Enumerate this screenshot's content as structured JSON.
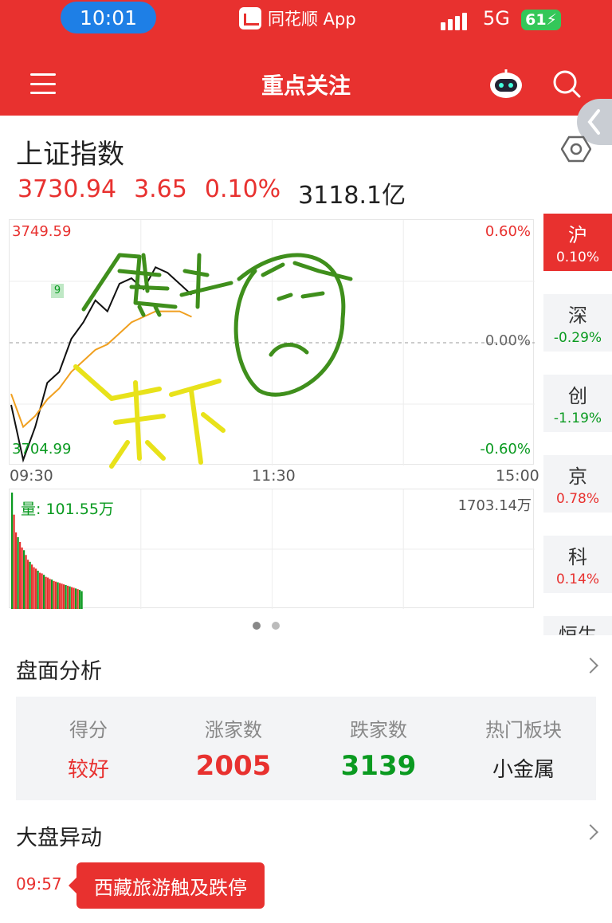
{
  "status_bar": {
    "time": "10:01",
    "app_name": "同花顺 App",
    "network": "5G",
    "battery": "61"
  },
  "header": {
    "title": "重点关注",
    "icons": [
      "menu-icon",
      "robot-assistant-icon",
      "search-icon"
    ]
  },
  "index": {
    "name": "上证指数",
    "price": "3730.94",
    "change": "3.65",
    "change_pct": "0.10%",
    "turnover": "3118.1亿"
  },
  "chart": {
    "high_label": "3749.59",
    "low_label": "3704.99",
    "pct_top": "0.60%",
    "pct_mid": "0.00%",
    "pct_bottom": "-0.60%",
    "marker": "9",
    "times": [
      "09:30",
      "11:30",
      "15:00"
    ],
    "volume_label": "量: 101.55万",
    "volume_max": "1703.14万",
    "colors": {
      "up": "#e8312f",
      "down": "#0a9a20",
      "price_line": "#111111",
      "avg_line": "#f0a020"
    }
  },
  "chart_data": {
    "type": "line",
    "title": "上证指数",
    "xlabel": "",
    "ylabel": "",
    "x_ticks": [
      "09:30",
      "11:30",
      "15:00"
    ],
    "ylim": [
      3704.99,
      3749.59
    ],
    "prev_close": 3727.29,
    "series": [
      {
        "name": "",
        "values": [
          3716,
          3706,
          3712,
          3720,
          3722,
          3728,
          3731,
          3735,
          3733,
          3738,
          3739,
          3737,
          3741,
          3740,
          3738,
          3736
        ]
      },
      {
        "name": "",
        "values": [
          3718,
          3712,
          3714,
          3717,
          3719,
          3722,
          3724,
          3726,
          3727,
          3729,
          3731,
          3732,
          3733,
          3733,
          3733,
          3732
        ]
      }
    ],
    "volume": {
      "values": [
        1703,
        1380,
        1120,
        1050,
        980,
        900,
        860,
        790,
        720,
        690,
        650,
        610,
        590,
        560,
        530,
        520,
        500,
        470,
        460,
        440,
        430,
        410,
        400,
        390,
        380,
        370,
        360,
        350,
        340,
        330,
        320,
        310,
        300,
        290,
        280,
        260
      ],
      "up": [
        false,
        true,
        true,
        false,
        true,
        true,
        false,
        true,
        true,
        false,
        true,
        true,
        true,
        false,
        true,
        true,
        false,
        true,
        true,
        true,
        false,
        true,
        true,
        false,
        true,
        true,
        true,
        false,
        true,
        false,
        true,
        true,
        false,
        true,
        false,
        false
      ]
    }
  },
  "side_tabs": [
    {
      "label": "沪",
      "value": "0.10%",
      "direction": "up",
      "active": true
    },
    {
      "label": "深",
      "value": "-0.29%",
      "direction": "down",
      "active": false
    },
    {
      "label": "创",
      "value": "-1.19%",
      "direction": "down",
      "active": false
    },
    {
      "label": "京",
      "value": "0.78%",
      "direction": "up",
      "active": false
    },
    {
      "label": "科",
      "value": "0.14%",
      "direction": "up",
      "active": false
    },
    {
      "label": "恒生",
      "value": "",
      "direction": "up",
      "active": false
    }
  ],
  "analysis": {
    "title": "盘面分析",
    "stats": [
      {
        "label": "得分",
        "value": "较好",
        "color": "red"
      },
      {
        "label": "涨家数",
        "value": "2005",
        "color": "red"
      },
      {
        "label": "跌家数",
        "value": "3139",
        "color": "green"
      },
      {
        "label": "热门板块",
        "value": "小金属",
        "color": "dark"
      }
    ]
  },
  "movers": {
    "title": "大盘异动",
    "time": "09:57",
    "event": "西藏旅游触及跌停"
  },
  "annotations": {
    "handwriting_top": "黑上",
    "handwriting_bottom": "黄下"
  }
}
